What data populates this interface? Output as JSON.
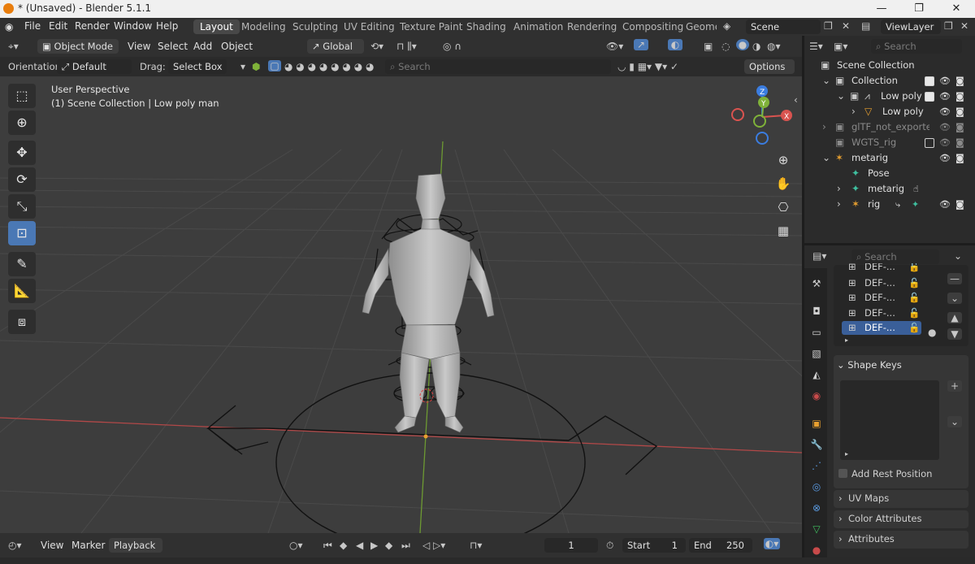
{
  "window": {
    "title": "* (Unsaved) - Blender 5.1.1",
    "minimize": "—",
    "maximize": "❐",
    "close": "✕"
  },
  "menu": {
    "file": "File",
    "edit": "Edit",
    "render": "Render",
    "window": "Window",
    "help": "Help"
  },
  "workspaces": [
    "Layout",
    "Modeling",
    "Sculpting",
    "UV Editing",
    "Texture Paint",
    "Shading",
    "Animation",
    "Rendering",
    "Compositing",
    "Geome"
  ],
  "scene": {
    "name": "Scene",
    "view_layer": "ViewLayer"
  },
  "viewport_header": {
    "mode": "Object Mode",
    "view": "View",
    "select": "Select",
    "add": "Add",
    "object": "Object",
    "transform": "Global"
  },
  "tool_settings": {
    "orientation_label": "Orientation:",
    "orientation_value": "Default",
    "drag_label": "Drag:",
    "drag_value": "Select Box",
    "search_placeholder": "Search",
    "options": "Options"
  },
  "viewport": {
    "perspective": "User Perspective",
    "info": "(1) Scene Collection | Low poly man"
  },
  "gizmo": {
    "x": "X",
    "y": "Y",
    "z": "Z"
  },
  "outliner": {
    "search_placeholder": "Search",
    "rows": [
      {
        "name": "Scene Collection"
      },
      {
        "name": "Collection"
      },
      {
        "name": "Low poly"
      },
      {
        "name": "Low poly"
      },
      {
        "name": "glTF_not_exporte"
      },
      {
        "name": "WGTS_rig"
      },
      {
        "name": "metarig"
      },
      {
        "name": "Pose"
      },
      {
        "name": "metarig"
      },
      {
        "name": "rig"
      }
    ]
  },
  "properties": {
    "search_placeholder": "Search",
    "groups": [
      "DEF-...",
      "DEF-...",
      "DEF-...",
      "DEF-...",
      "DEF-..."
    ],
    "shape_keys": "Shape Keys",
    "add_rest_position": "Add Rest Position",
    "uv_maps": "UV Maps",
    "color_attributes": "Color Attributes",
    "attributes": "Attributes"
  },
  "timeline": {
    "view": "View",
    "marker": "Marker",
    "playback": "Playback",
    "current_frame": "1",
    "start_label": "Start",
    "start": "1",
    "end_label": "End",
    "end": "250"
  },
  "colors": {
    "accent": "#4a78b5",
    "x_axis": "#d9534f",
    "y_axis": "#7fb239",
    "z_axis": "#3b7de0"
  }
}
